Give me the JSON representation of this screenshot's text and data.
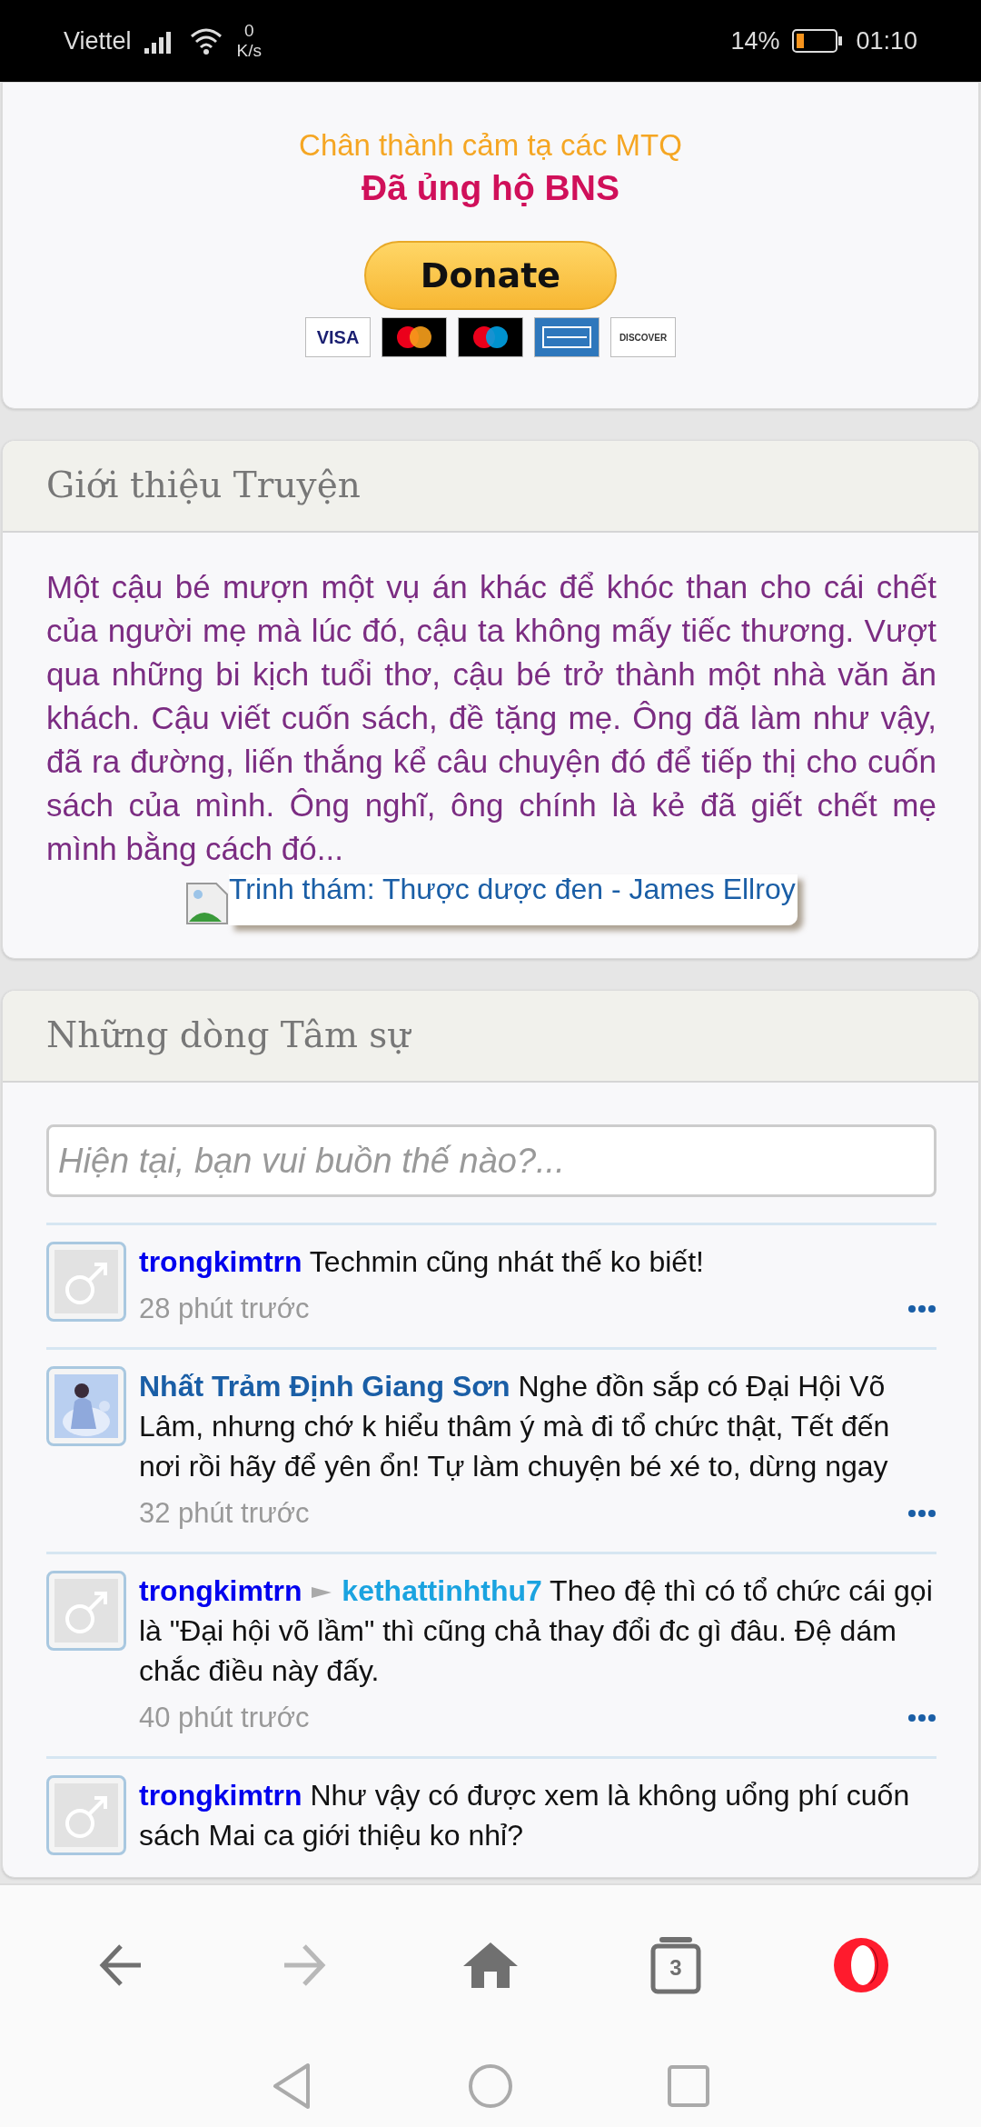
{
  "status_bar": {
    "carrier": "Viettel",
    "speed_value": "0",
    "speed_unit": "K/s",
    "battery": "14%",
    "time": "01:10"
  },
  "donate_card": {
    "thanks": "Chân thành cảm tạ các MTQ",
    "supporters": "Đã ủng hộ BNS",
    "button": "Donate",
    "payment_cards": [
      {
        "kind": "visa",
        "label": "VISA"
      },
      {
        "kind": "mastercard"
      },
      {
        "kind": "maestro"
      },
      {
        "kind": "amex"
      },
      {
        "kind": "discover",
        "label": "DISCOVER"
      }
    ]
  },
  "intro_card": {
    "title": "Giới thiệu Truyện",
    "summary": "Một cậu bé mượn một vụ án khác để khóc than cho cái chết của người mẹ mà lúc đó, cậu ta không mấy tiếc thương. Vượt qua những bi kịch tuổi thơ, cậu bé trở thành một nhà văn ăn khách. Cậu viết cuốn sách, đề tặng mẹ. Ông đã làm như vậy, đã ra đường, liến thắng kể câu chuyện đó để tiếp thị cho cuốn sách của mình. Ông nghĩ, ông chính là kẻ đã giết chết mẹ mình bằng cách đó...",
    "book_link": "Trinh thám: Thược dược đen - James Ellroy"
  },
  "shout_card": {
    "title": "Những dòng Tâm sự",
    "input": {
      "placeholder": "Hiện tại, bạn vui buồn thế nào?..."
    },
    "posts": [
      {
        "kind": "default",
        "author": "trongkimtrn",
        "color": "#0000ee",
        "message": "Techmin cũng nhát thế ko biết!",
        "time": "28 phút trước"
      },
      {
        "kind": "picture",
        "author": "Nhất Trảm Định Giang Sơn",
        "color": "#1a5ea6",
        "message": "Nghe đồn sắp có Đại Hội Võ Lâm, nhưng chớ k hiểu thâm ý mà đi tổ chức thật, Tết đến nơi rồi hãy để yên ổn! Tự làm chuyện bé xé to, dừng ngay",
        "time": "32 phút trước"
      },
      {
        "kind": "default",
        "author": "trongkimtrn",
        "color": "#0000ee",
        "recipient": "kethattinhthu7",
        "message": "Theo đệ thì có tổ chức cái gọi là \"Đại hội võ lầm\" thì cũng chả thay đổi đc gì đâu. Đệ dám chắc điều này đấy.",
        "time": "40 phút trước"
      },
      {
        "kind": "default",
        "author": "trongkimtrn",
        "color": "#0000ee",
        "message": "Như vậy có được xem là không uổng phí cuốn sách Mai ca giới thiệu ko nhỉ?"
      }
    ]
  },
  "browser_bar": {
    "tab_count": "3",
    "forward_disabled": true
  }
}
